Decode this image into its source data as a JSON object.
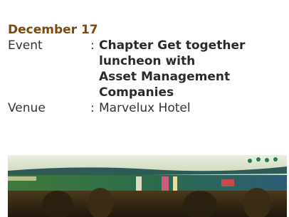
{
  "event_block": {
    "date": "December 17",
    "event_label": "Event",
    "event_separator": ":",
    "event_title_lines": [
      "Chapter Get together",
      "luncheon with",
      "Asset Management",
      "Companies"
    ],
    "venue_label": "Venue",
    "venue_separator": ":",
    "venue_value": "Marvelux Hotel"
  },
  "colors": {
    "date_text": "#7a4a10",
    "body_text": "#333333"
  },
  "photo": {
    "icon": "event-photo"
  }
}
